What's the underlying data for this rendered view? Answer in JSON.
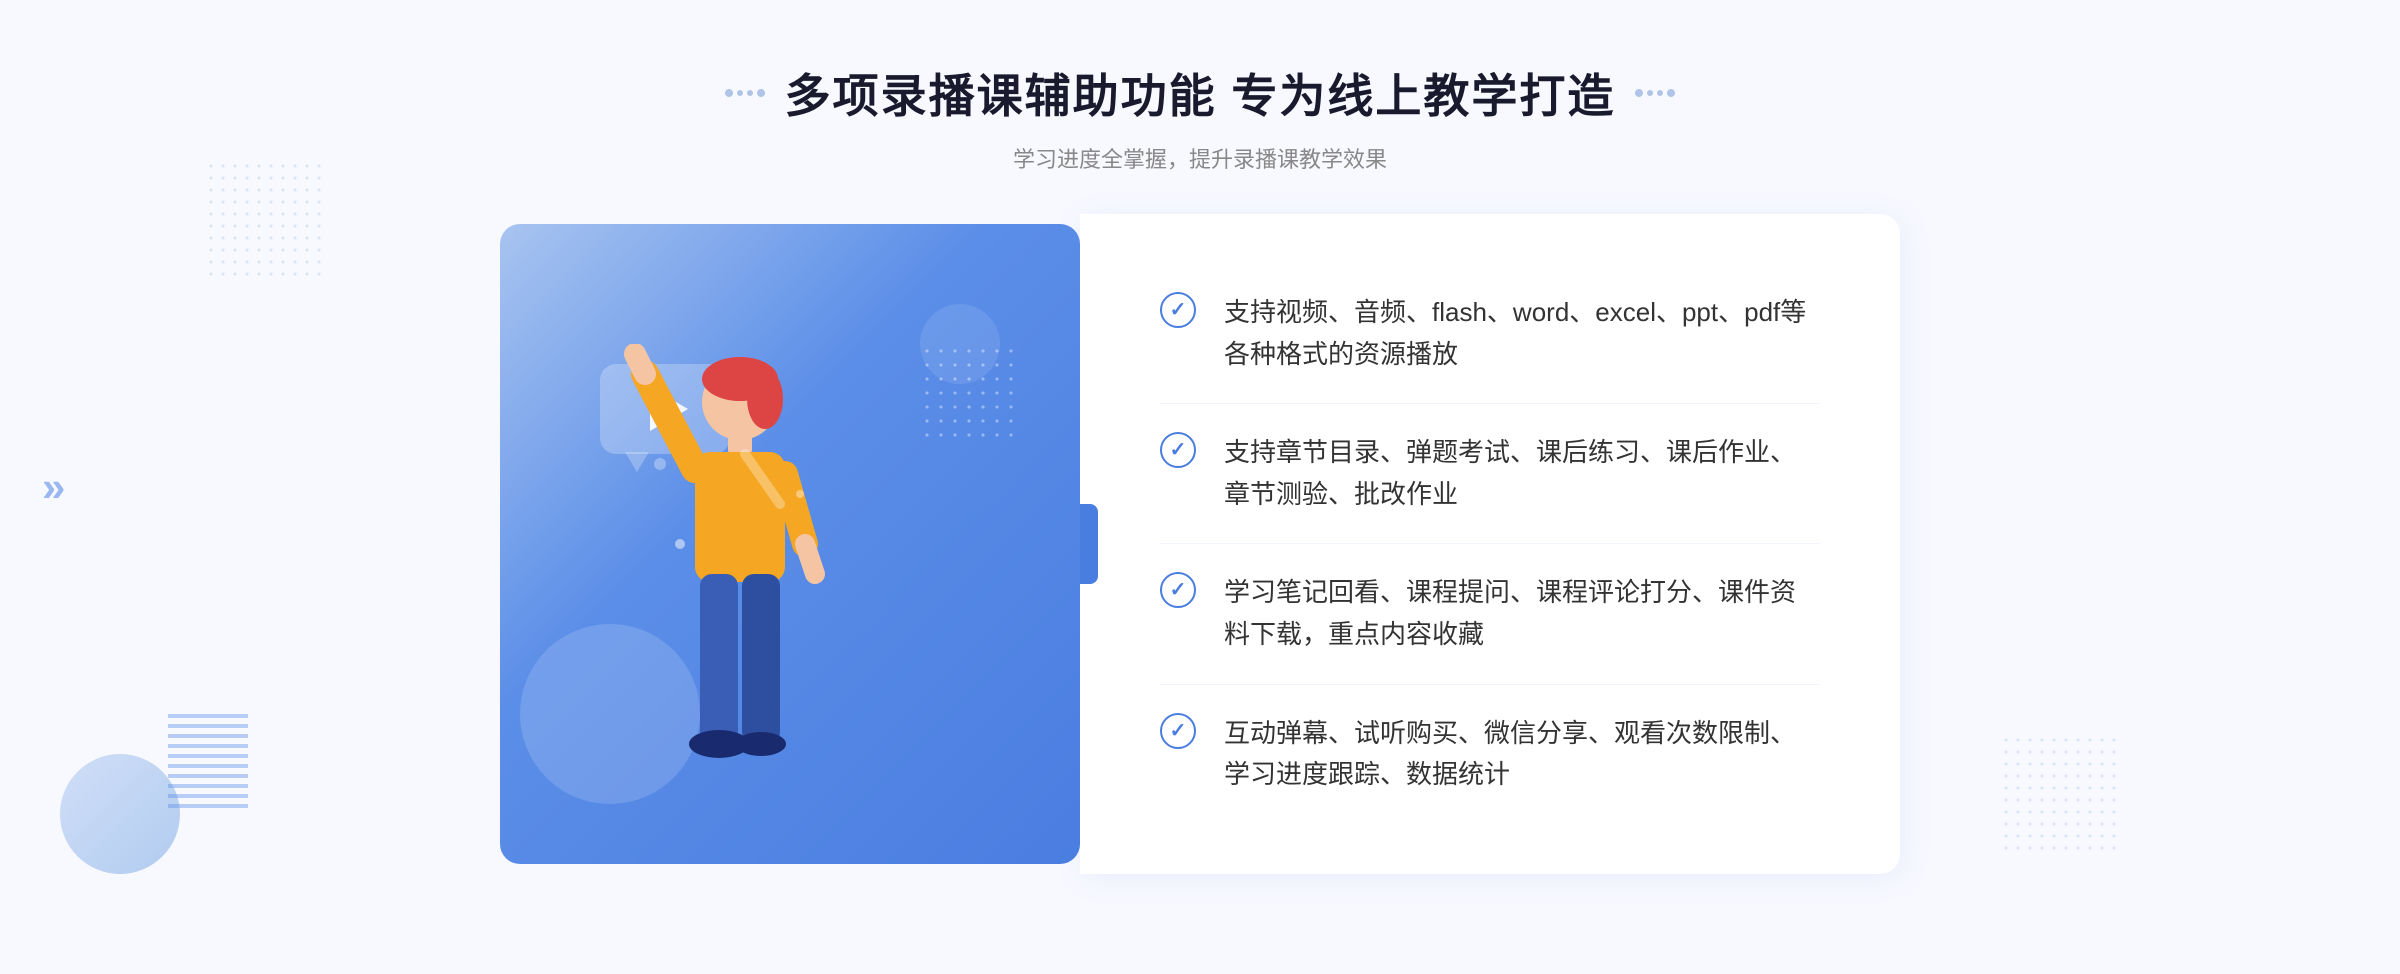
{
  "header": {
    "title": "多项录播课辅助功能 专为线上教学打造",
    "subtitle": "学习进度全掌握，提升录播课教学效果"
  },
  "features": [
    {
      "id": "feature-1",
      "text": "支持视频、音频、flash、word、excel、ppt、pdf等各种格式的资源播放"
    },
    {
      "id": "feature-2",
      "text": "支持章节目录、弹题考试、课后练习、课后作业、章节测验、批改作业"
    },
    {
      "id": "feature-3",
      "text": "学习笔记回看、课程提问、课程评论打分、课件资料下载，重点内容收藏"
    },
    {
      "id": "feature-4",
      "text": "互动弹幕、试听购买、微信分享、观看次数限制、学习进度跟踪、数据统计"
    }
  ],
  "decoration": {
    "chevron_left": "»",
    "chevron_right": "«"
  }
}
